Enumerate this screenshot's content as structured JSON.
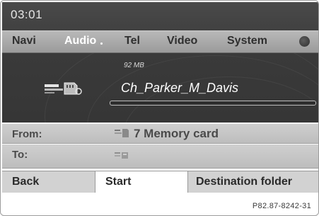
{
  "status": {
    "clock": "03:01"
  },
  "menu": {
    "items": [
      {
        "label": "Navi"
      },
      {
        "label": "Audio"
      },
      {
        "label": "Tel"
      },
      {
        "label": "Video"
      },
      {
        "label": "System"
      }
    ],
    "active": "Audio"
  },
  "now_playing": {
    "sub_label": "92 MB",
    "title": "Ch_Parker_M_Davis",
    "source_icon": "memory-card-icon",
    "progress": 0
  },
  "transfer": {
    "from_label": "From:",
    "from_value": "7 Memory card",
    "from_icon": "memory-card-icon",
    "to_label": "To:",
    "to_value": "",
    "to_icon": "media-storage-icon"
  },
  "softkeys": {
    "back": "Back",
    "start": "Start",
    "destination": "Destination folder"
  },
  "reference_code": "P82.87-8242-31",
  "colors": {
    "screen_bg": "#3c3c3c",
    "menu_bar": "#a8a8a8",
    "row_bg": "#c4c4c4",
    "active_menu_text": "#ffffff",
    "selected_softkey_bg": "#ffffff"
  }
}
